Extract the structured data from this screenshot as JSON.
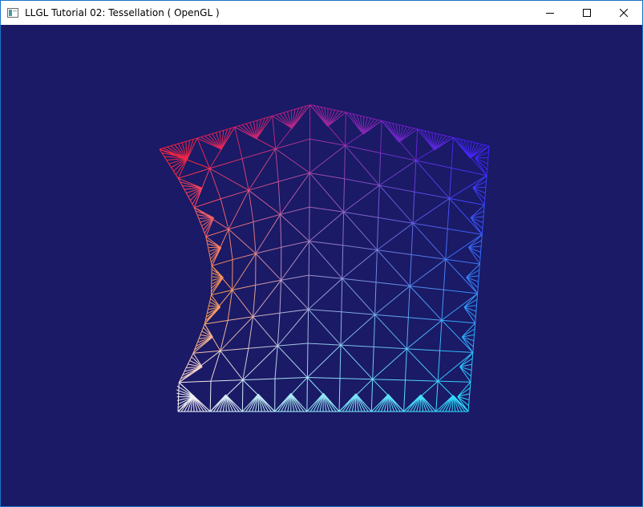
{
  "window": {
    "title": "LLGL Tutorial 02: Tessellation ( OpenGL )",
    "background_color": "#1a1a66"
  },
  "title_buttons": {
    "minimize_icon": "minimize-icon",
    "maximize_icon": "maximize-icon",
    "close_icon": "close-icon"
  },
  "render": {
    "primitive": "wireframe tessellated quad",
    "corner_colors": {
      "top_left": "#ff1a2e",
      "top_right": "#3a1aff",
      "bottom_left": "#ffffff",
      "bottom_right": "#22e6ff",
      "left_mid": "#ff9a22"
    }
  }
}
